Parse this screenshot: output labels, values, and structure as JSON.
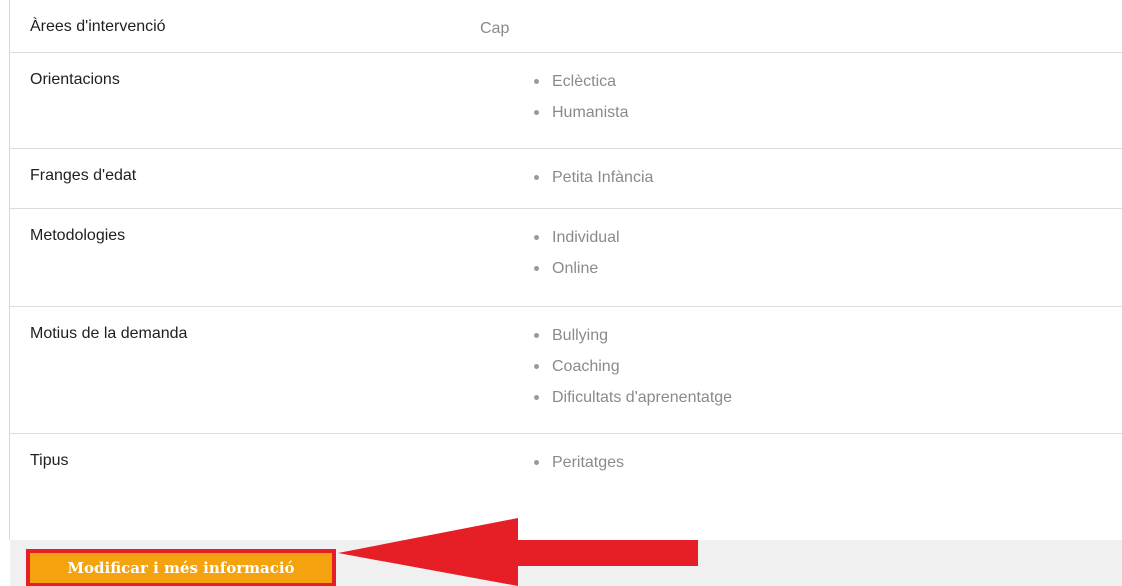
{
  "rows": [
    {
      "label": "Àrees d'intervenció",
      "value": "Cap"
    },
    {
      "label": "Orientacions",
      "items": [
        "Eclèctica",
        "Humanista"
      ]
    },
    {
      "label": "Franges d'edat",
      "items": [
        "Petita Infància"
      ]
    },
    {
      "label": "Metodologies",
      "items": [
        "Individual",
        "Online"
      ]
    },
    {
      "label": "Motius de la demanda",
      "items": [
        "Bullying",
        "Coaching",
        "Dificultats d'aprenentatge"
      ]
    },
    {
      "label": "Tipus",
      "items": [
        "Peritatges"
      ]
    }
  ],
  "footer": {
    "button_label": "Modificar i més informació"
  },
  "colors": {
    "button_bg": "#f4a30f",
    "annotation_red": "#e61e26",
    "label_text": "#1f1f1f",
    "value_text": "#8a8a8a"
  },
  "icons": {
    "annotation_arrow": "left-arrow-icon",
    "bullet": "bullet-dot-icon"
  }
}
